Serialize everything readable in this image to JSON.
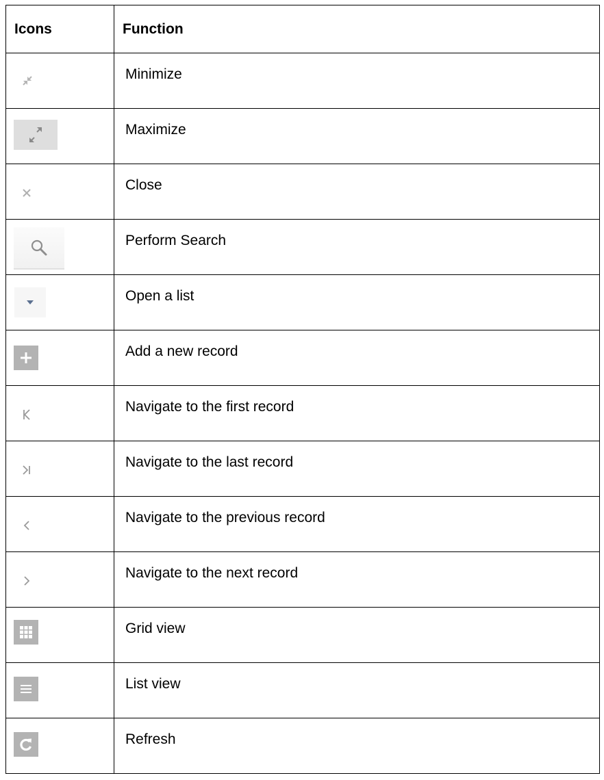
{
  "table": {
    "headers": {
      "icons": "Icons",
      "function": "Function"
    },
    "rows": [
      {
        "icon": "minimize-icon",
        "function": "Minimize"
      },
      {
        "icon": "maximize-icon",
        "function": "Maximize"
      },
      {
        "icon": "close-icon",
        "function": "Close"
      },
      {
        "icon": "search-icon",
        "function": "Perform Search"
      },
      {
        "icon": "dropdown-arrow-icon",
        "function": "Open a list"
      },
      {
        "icon": "plus-icon",
        "function": "Add a new record"
      },
      {
        "icon": "first-record-icon",
        "function": "Navigate to the first record"
      },
      {
        "icon": "last-record-icon",
        "function": "Navigate to the last record"
      },
      {
        "icon": "previous-icon",
        "function": "Navigate to the previous record"
      },
      {
        "icon": "next-icon",
        "function": "Navigate to the next record"
      },
      {
        "icon": "grid-view-icon",
        "function": "Grid view"
      },
      {
        "icon": "list-view-icon",
        "function": "List view"
      },
      {
        "icon": "refresh-icon",
        "function": "Refresh"
      }
    ]
  },
  "colors": {
    "icon_grey": "#a8a8a8",
    "icon_dark": "#7a7a7a",
    "arrow_blue": "#5b7090",
    "square_grey": "#b3b3b3"
  }
}
